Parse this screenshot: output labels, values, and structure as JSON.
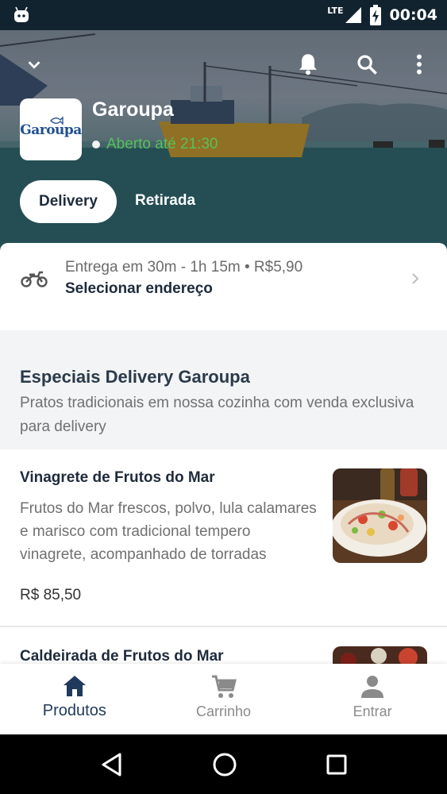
{
  "status_bar": {
    "network": "LTE",
    "time": "00:04",
    "icons": [
      "android-robot-icon",
      "signal-icon",
      "battery-charging-icon"
    ]
  },
  "header": {
    "icons": [
      "chevron-down-icon",
      "bell-icon",
      "search-icon",
      "more-vert-icon"
    ],
    "logo_text": "Garoupa",
    "store_name": "Garoupa",
    "open_status": "Aberto até 21:30",
    "open_color": "#55c25a"
  },
  "tabs": {
    "delivery": "Delivery",
    "retirada": "Retirada",
    "selected": "Delivery"
  },
  "address": {
    "icon": "motorcycle-icon",
    "line1": "Entrega em 30m - 1h 15m • R$5,90",
    "line2": "Selecionar endereço"
  },
  "section": {
    "title": "Especiais Delivery Garoupa",
    "description": "Pratos tradicionais em nossa cozinha com venda exclusiva para delivery"
  },
  "products": [
    {
      "name": "Vinagrete de Frutos do Mar",
      "description": "Frutos do Mar frescos, polvo, lula calamares e marisco com tradicional tempero vinagrete, acompanhado de torradas",
      "price": "R$ 85,50"
    },
    {
      "name": "Caldeirada de Frutos do Mar"
    }
  ],
  "bottom_nav": {
    "items": [
      {
        "label": "Produtos",
        "icon": "home-icon",
        "active": true
      },
      {
        "label": "Carrinho",
        "icon": "cart-icon",
        "active": false
      },
      {
        "label": "Entrar",
        "icon": "person-icon",
        "active": false
      }
    ],
    "active_color": "#1f3a5c"
  },
  "system_nav": [
    "back-icon",
    "home-circle-icon",
    "recents-icon"
  ]
}
